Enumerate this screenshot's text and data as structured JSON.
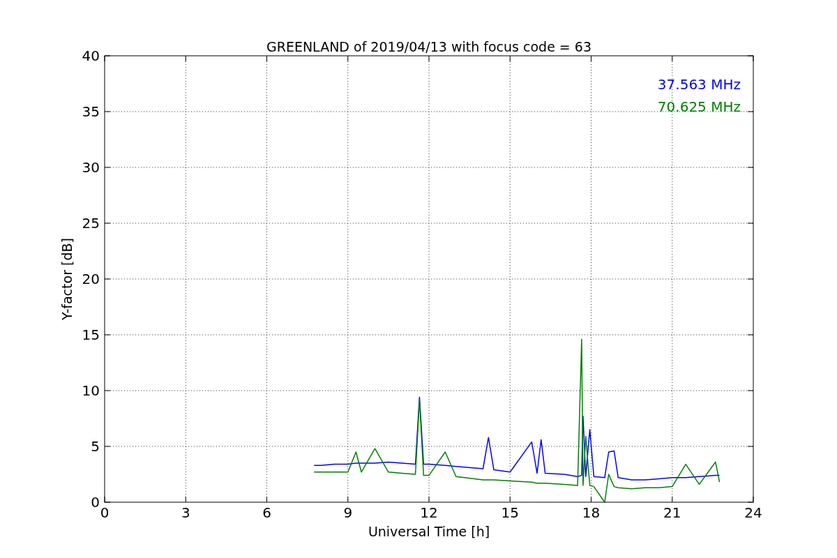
{
  "figure": {
    "chart_data": {
      "type": "line",
      "title": "GREENLAND of 2019/04/13 with focus code = 63",
      "xlabel": "Universal Time [h]",
      "ylabel": "Y-factor [dB]",
      "x": [
        7.75,
        8,
        8.5,
        9,
        9.3,
        9.5,
        10,
        10.5,
        11,
        11.5,
        11.65,
        11.8,
        12,
        12.6,
        13,
        14,
        14.2,
        14.4,
        15,
        15.8,
        16,
        16.15,
        16.3,
        17,
        17.5,
        17.65,
        17.7,
        17.8,
        17.95,
        18.1,
        18.5,
        18.65,
        18.85,
        19,
        19.5,
        20,
        20.5,
        21,
        21.5,
        22,
        22.6,
        22.75
      ],
      "series": [
        {
          "name": "37.563 MHz",
          "color": "#0000ff",
          "values": [
            3.3,
            3.3,
            3.4,
            3.4,
            3.5,
            3.5,
            3.5,
            3.6,
            3.5,
            3.4,
            9.4,
            3.4,
            3.4,
            3.3,
            3.2,
            3.0,
            5.8,
            2.9,
            2.7,
            5.4,
            2.6,
            5.6,
            2.6,
            2.5,
            2.3,
            2.4,
            7.7,
            2.3,
            6.5,
            2.3,
            2.2,
            4.5,
            4.6,
            2.2,
            2.0,
            2.0,
            2.1,
            2.2,
            2.2,
            2.3,
            2.4,
            2.4
          ]
        },
        {
          "name": "70.625 MHz",
          "color": "#008000",
          "values": [
            2.7,
            2.7,
            2.7,
            2.7,
            4.5,
            2.7,
            4.8,
            2.7,
            2.6,
            2.5,
            9.2,
            2.4,
            2.4,
            4.5,
            2.3,
            2.0,
            2.0,
            2.0,
            1.9,
            1.8,
            1.7,
            1.7,
            1.7,
            1.6,
            1.5,
            14.6,
            1.5,
            5.9,
            1.5,
            1.4,
            0.0,
            2.5,
            1.4,
            1.3,
            1.2,
            1.3,
            1.3,
            1.4,
            3.4,
            1.6,
            3.6,
            1.8
          ]
        }
      ],
      "xlim": [
        0,
        24
      ],
      "ylim": [
        0,
        40
      ],
      "xticks": [
        0,
        3,
        6,
        9,
        12,
        15,
        18,
        21,
        24
      ],
      "yticks": [
        0,
        5,
        10,
        15,
        20,
        25,
        30,
        35,
        40
      ],
      "grid": true
    }
  }
}
